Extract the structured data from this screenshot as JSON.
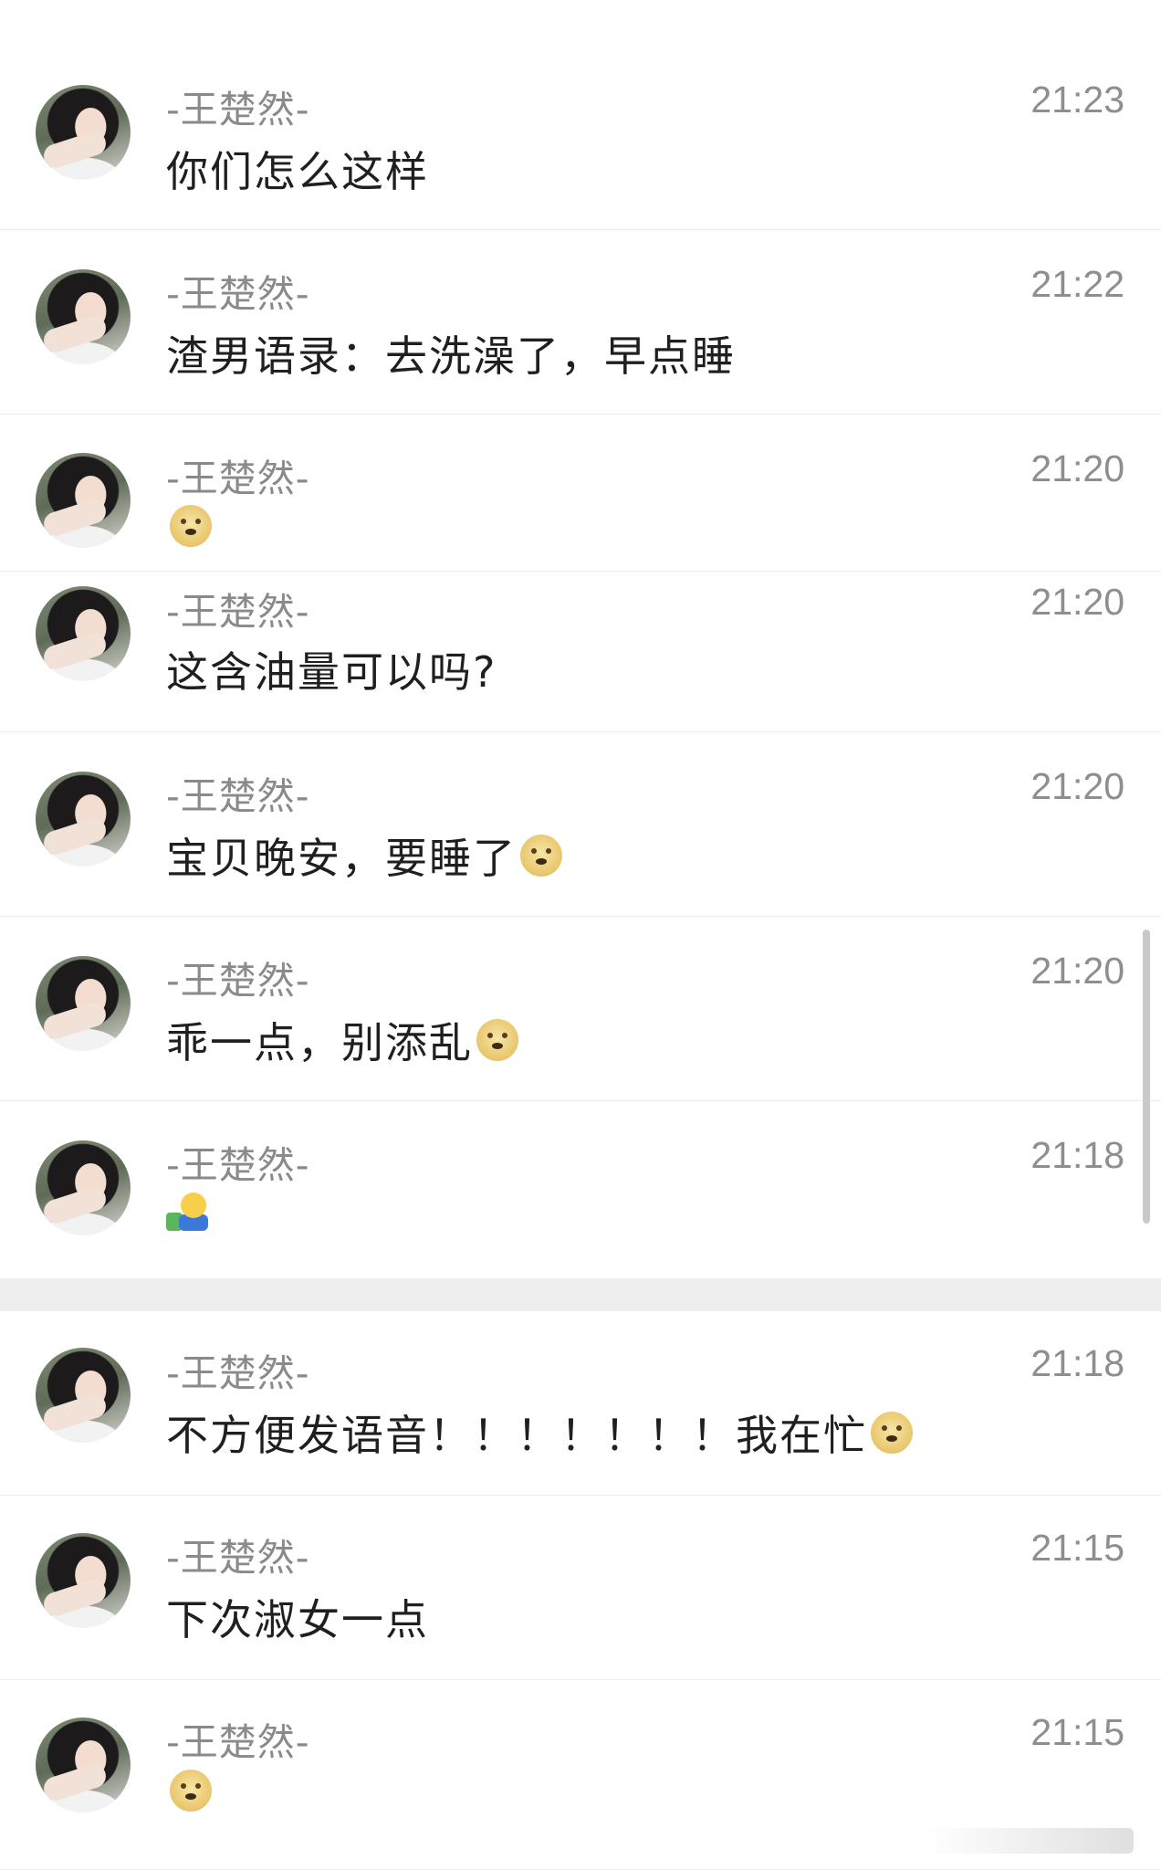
{
  "messages": [
    {
      "sender": "-王楚然-",
      "time": "21:23",
      "text": "你们怎么这样",
      "emoji": ""
    },
    {
      "sender": "-王楚然-",
      "time": "21:22",
      "text": "渣男语录：去洗澡了，早点睡",
      "emoji": ""
    },
    {
      "sender": "-王楚然-",
      "time": "21:20",
      "text": "",
      "emoji": "doge"
    },
    {
      "sender": "-王楚然-",
      "time": "21:20",
      "text": "这含油量可以吗?",
      "emoji": ""
    },
    {
      "sender": "-王楚然-",
      "time": "21:20",
      "text": "宝贝晚安，要睡了",
      "emoji": "doge"
    },
    {
      "sender": "-王楚然-",
      "time": "21:20",
      "text": "乖一点，别添乱",
      "emoji": "doge"
    },
    {
      "sender": "-王楚然-",
      "time": "21:18",
      "text": "",
      "emoji": "person-watering-plant"
    },
    {
      "sender": "-王楚然-",
      "time": "21:18",
      "text": "不方便发语音！！！！！！！我在忙",
      "emoji": "doge"
    },
    {
      "sender": "-王楚然-",
      "time": "21:15",
      "text": "下次淑女一点",
      "emoji": ""
    },
    {
      "sender": "-王楚然-",
      "time": "21:15",
      "text": "",
      "emoji": "doge"
    }
  ]
}
